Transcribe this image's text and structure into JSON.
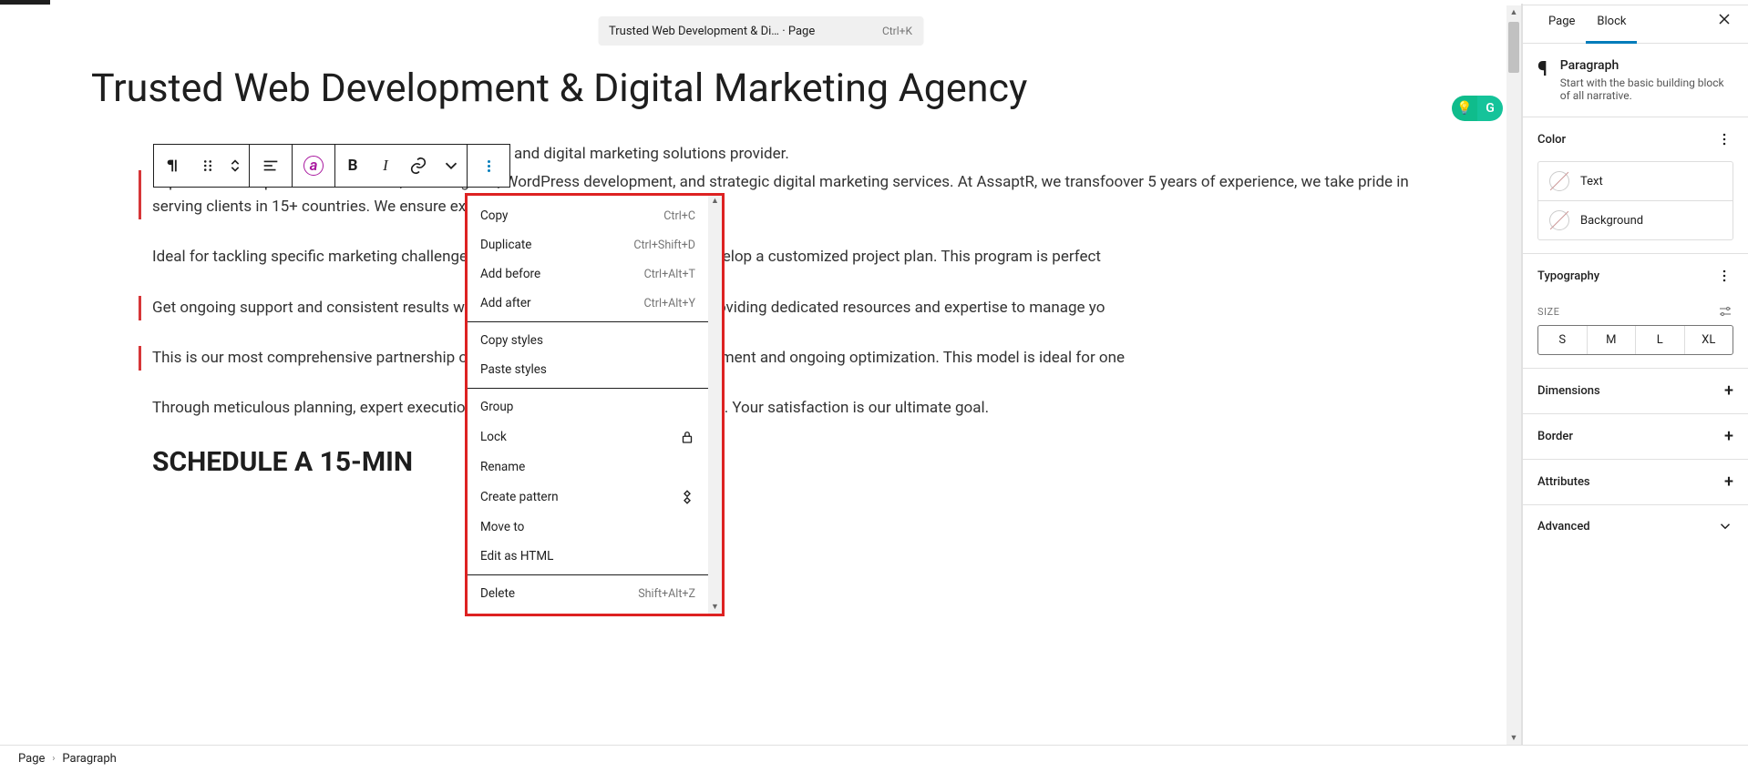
{
  "titlebar": {
    "text": "Trusted Web Development & Di… · Page",
    "shortcut": "Ctrl+K"
  },
  "content": {
    "h1": "Trusted Web Development & Digital Marketing Agency",
    "line_top": "company and digital marketing solutions provider.",
    "p1": "Explore our comprehensive services, including ecs, WordPress development, and strategic digital marketing services. At AssaptR, we transfoover 5 years of experience, we take pride in serving clients in 15+ countries. We ensure excelsolutions we offer.",
    "p2": "Ideal for tackling specific marketing challenges oto define success metrics and develop a customized project plan. This program is perfect",
    "p3": "Get ongoing support and consistent results with onsion of your marketing team, providing dedicated resources and expertise to manage yo",
    "p4a": "This is our most comprehensive partnership optio",
    "p4b": "oviding",
    "p4c": " in-depth strategy development and ongoing optimization. This model is ideal for one",
    "p5": "Through meticulous planning, expert execution, aothing short of exceptional results. Your satisfaction is our ultimate goal.",
    "h2": "SCHEDULE A 15-MIN "
  },
  "toolbar": {
    "bold": "B",
    "italic": "I",
    "ai": "ⓐ"
  },
  "dropdown": {
    "items": [
      {
        "label": "Copy",
        "shortcut": "Ctrl+C"
      },
      {
        "label": "Duplicate",
        "shortcut": "Ctrl+Shift+D"
      },
      {
        "label": "Add before",
        "shortcut": "Ctrl+Alt+T"
      },
      {
        "label": "Add after",
        "shortcut": "Ctrl+Alt+Y"
      }
    ],
    "items2": [
      {
        "label": "Copy styles"
      },
      {
        "label": "Paste styles"
      }
    ],
    "items3": [
      {
        "label": "Group"
      },
      {
        "label": "Lock",
        "icon": "lock"
      },
      {
        "label": "Rename"
      },
      {
        "label": "Create pattern",
        "icon": "pattern"
      },
      {
        "label": "Move to"
      },
      {
        "label": "Edit as HTML"
      }
    ],
    "items4": [
      {
        "label": "Delete",
        "shortcut": "Shift+Alt+Z"
      }
    ]
  },
  "sidebar": {
    "tab_page": "Page",
    "tab_block": "Block",
    "block_name": "Paragraph",
    "block_desc": "Start with the basic building block of all narrative.",
    "sec_color": "Color",
    "color_text": "Text",
    "color_bg": "Background",
    "sec_typo": "Typography",
    "size_label": "SIZE",
    "sizes": [
      "S",
      "M",
      "L",
      "XL"
    ],
    "sec_dim": "Dimensions",
    "sec_border": "Border",
    "sec_attr": "Attributes",
    "sec_adv": "Advanced"
  },
  "footer": {
    "crumb1": "Page",
    "crumb2": "Paragraph"
  }
}
